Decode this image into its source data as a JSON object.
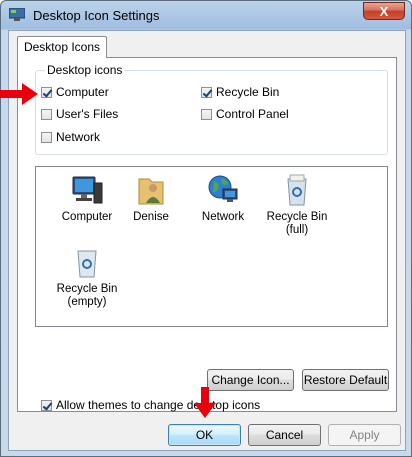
{
  "window": {
    "title": "Desktop Icon Settings",
    "close_label": "X"
  },
  "tabs": [
    {
      "label": "Desktop Icons"
    }
  ],
  "desktop_icons_group": {
    "legend": "Desktop icons",
    "checkboxes": [
      {
        "label": "Computer",
        "checked": true
      },
      {
        "label": "Recycle Bin",
        "checked": true
      },
      {
        "label": "User's Files",
        "checked": false
      },
      {
        "label": "Control Panel",
        "checked": false
      },
      {
        "label": "Network",
        "checked": false
      }
    ]
  },
  "icon_list": [
    {
      "label": "Computer",
      "icon": "computer-icon"
    },
    {
      "label": "Denise",
      "icon": "user-folder-icon"
    },
    {
      "label": "Network",
      "icon": "network-globe-icon"
    },
    {
      "label": "Recycle Bin\n(full)",
      "icon": "recycle-bin-full-icon"
    },
    {
      "label": "Recycle Bin\n(empty)",
      "icon": "recycle-bin-empty-icon"
    }
  ],
  "buttons": {
    "change_icon": "Change Icon...",
    "restore_default": "Restore Default",
    "ok": "OK",
    "cancel": "Cancel",
    "apply": "Apply"
  },
  "allow_themes": {
    "label": "Allow themes to change desktop icons",
    "checked": true
  },
  "colors": {
    "annotation_arrow": "#e8000c",
    "title_bar": "#9fbde0",
    "accent": "#3c7fb1"
  }
}
